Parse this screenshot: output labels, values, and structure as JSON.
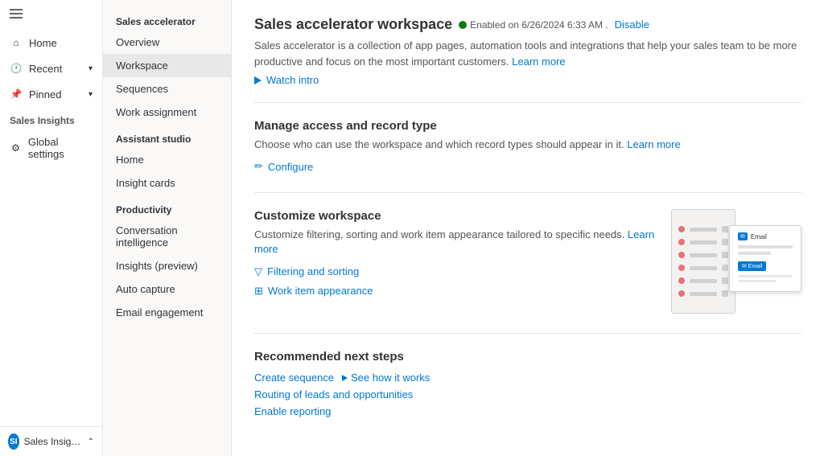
{
  "leftNav": {
    "items": [
      {
        "label": "Home",
        "icon": "🏠"
      },
      {
        "label": "Recent",
        "icon": "🕐",
        "hasChevron": true
      },
      {
        "label": "Pinned",
        "icon": "📌",
        "hasChevron": true
      }
    ],
    "salesInsightsLabel": "Sales Insights",
    "globalSettings": "Global settings"
  },
  "midNav": {
    "salesAcceleratorLabel": "Sales accelerator",
    "items": [
      {
        "label": "Overview",
        "active": false
      },
      {
        "label": "Workspace",
        "active": true
      },
      {
        "label": "Sequences",
        "active": false
      },
      {
        "label": "Work assignment",
        "active": false
      }
    ],
    "assistantStudioLabel": "Assistant studio",
    "assistantItems": [
      {
        "label": "Home",
        "active": false
      },
      {
        "label": "Insight cards",
        "active": false
      }
    ],
    "productivityLabel": "Productivity",
    "productivityItems": [
      {
        "label": "Conversation intelligence",
        "active": false
      },
      {
        "label": "Insights (preview)",
        "active": false
      },
      {
        "label": "Auto capture",
        "active": false
      },
      {
        "label": "Email engagement",
        "active": false
      }
    ]
  },
  "mainContent": {
    "title": "Sales accelerator workspace",
    "statusText": "Enabled on 6/26/2024 6:33 AM .",
    "disableLabel": "Disable",
    "description": "Sales accelerator is a collection of app pages, automation tools and integrations that help your sales team to be more productive and focus on the most important customers.",
    "learnMoreLabel": "Learn more",
    "watchIntroLabel": "Watch intro",
    "manageAccess": {
      "title": "Manage access and record type",
      "description": "Choose who can use the workspace and which record types should appear in it.",
      "learnMoreLabel": "Learn more",
      "configureLabel": "Configure"
    },
    "customizeWorkspace": {
      "title": "Customize workspace",
      "description": "Customize filtering, sorting and work item appearance tailored to specific needs.",
      "learnMoreLabel": "Learn more",
      "filteringLabel": "Filtering and sorting",
      "workItemLabel": "Work item appearance"
    },
    "nextSteps": {
      "title": "Recommended next steps",
      "createSequence": "Create sequence",
      "seeHowItWorks": "See how it works",
      "routingLabel": "Routing of leads and opportunities",
      "enableReporting": "Enable reporting"
    }
  },
  "bottomBar": {
    "label": "Sales Insights sett...",
    "avatarText": "SI"
  },
  "previewDots": [
    {
      "color": "#e57373"
    },
    {
      "color": "#e57373"
    },
    {
      "color": "#e57373"
    },
    {
      "color": "#e57373"
    },
    {
      "color": "#e57373"
    },
    {
      "color": "#e57373"
    }
  ]
}
